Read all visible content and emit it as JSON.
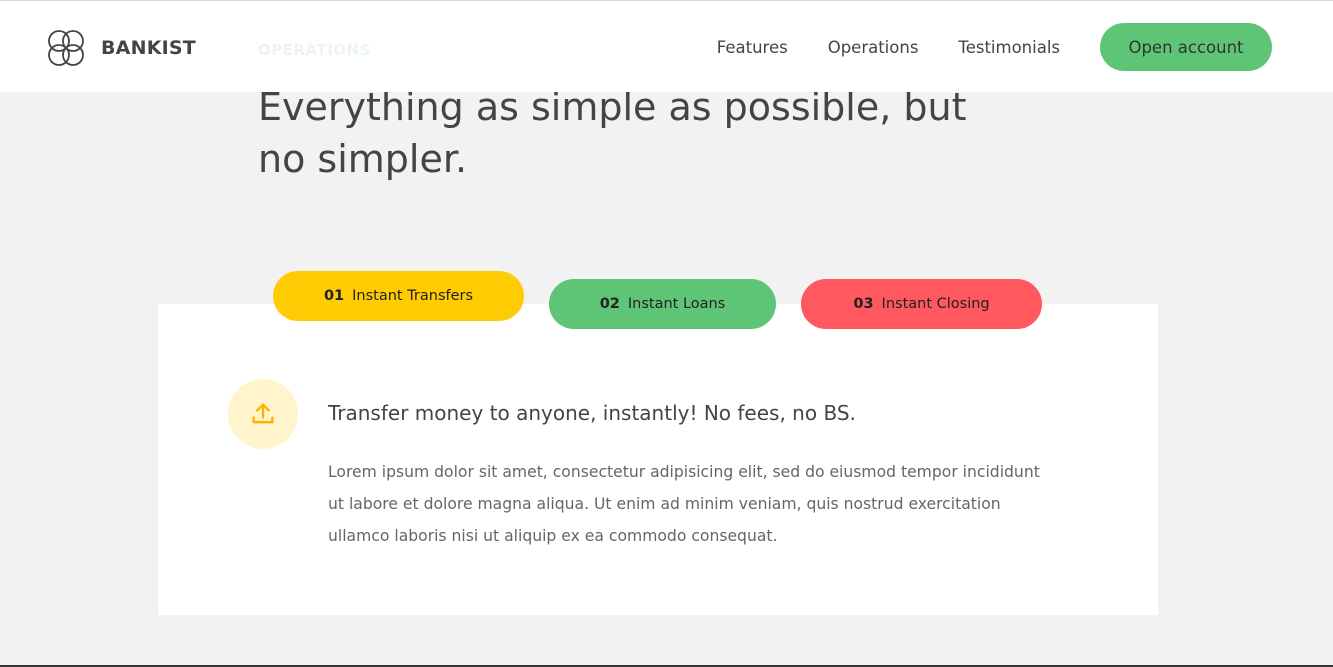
{
  "nav": {
    "logo_text": "BANKIST",
    "links": [
      "Features",
      "Operations",
      "Testimonials"
    ],
    "cta_label": "Open account"
  },
  "section": {
    "label": "Operations",
    "title": "Everything as simple as possible, but no simpler."
  },
  "tabs": [
    {
      "num": "01",
      "label": "Instant Transfers",
      "color": "#ffcb03",
      "active": true
    },
    {
      "num": "02",
      "label": "Instant Loans",
      "color": "#5ec576",
      "active": false
    },
    {
      "num": "03",
      "label": "Instant Closing",
      "color": "#ff585f",
      "active": false
    }
  ],
  "content": {
    "icon": "upload-icon",
    "heading": "Transfer money to anyone, instantly! No fees, no BS.",
    "text": "Lorem ipsum dolor sit amet, consectetur adipisicing elit, sed do eiusmod tempor incididunt ut labore et dolore magna aliqua. Ut enim ad minim veniam, quis nostrud exercitation ullamco laboris nisi ut aliquip ex ea commodo consequat."
  },
  "colors": {
    "primary": "#5ec576",
    "secondary": "#ffcb03",
    "tertiary": "#ff585f",
    "icon_bg": "#fff4cc"
  }
}
